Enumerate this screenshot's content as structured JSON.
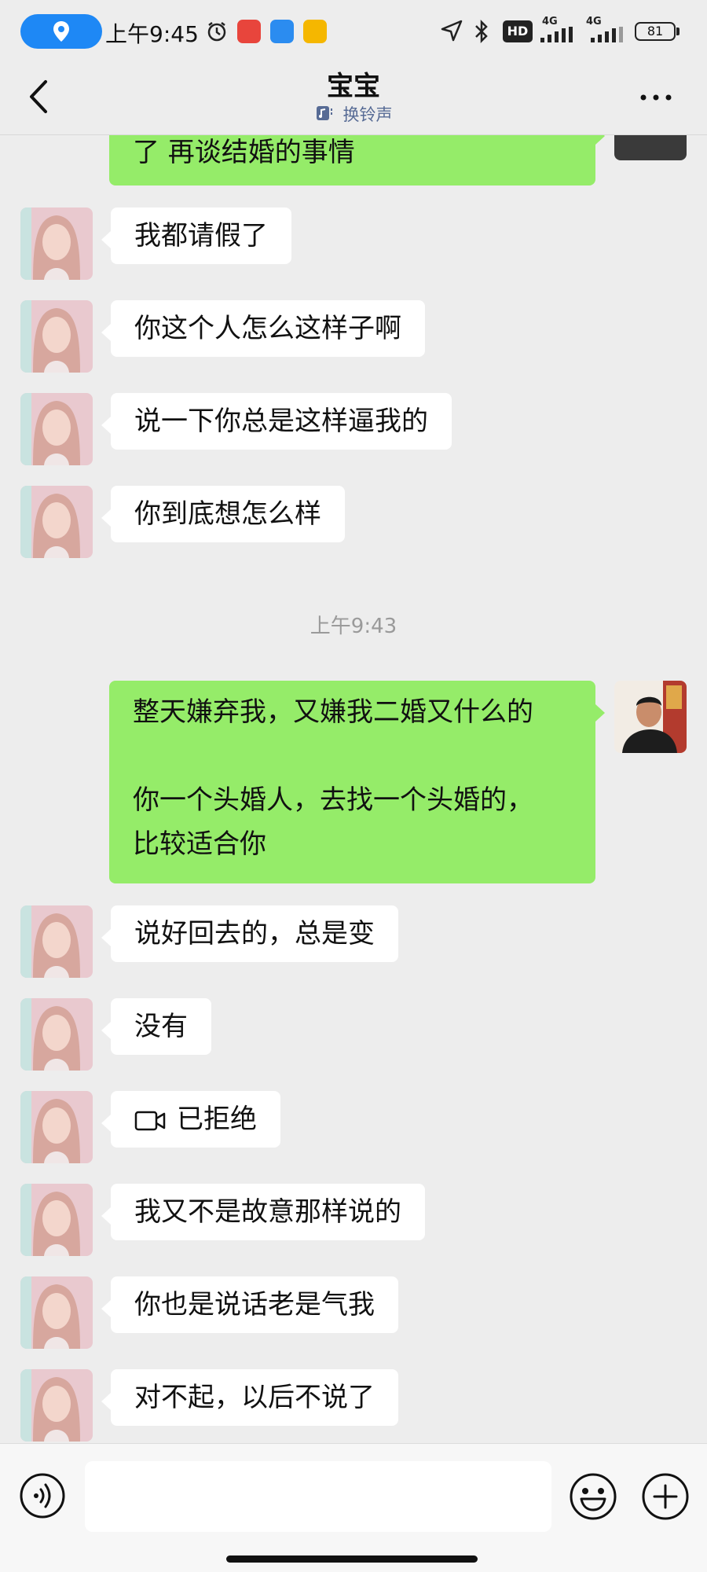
{
  "status_bar": {
    "time": "上午9:45",
    "network_1": "4G",
    "network_2": "4G",
    "hd_label": "HD",
    "battery": "81"
  },
  "navbar": {
    "title": "宝宝",
    "subtitle": "换铃声"
  },
  "messages": {
    "m0": "了  再谈结婚的事情",
    "m1": "我都请假了",
    "m2": "你这个人怎么这样子啊",
    "m3": "说一下你总是这样逼我的",
    "m4": "你到底想怎么样",
    "timestamp": "上午9:43",
    "m5_line1": "整天嫌弃我，又嫌我二婚又什么的",
    "m5_line2": "你一个头婚人，去找一个头婚的，",
    "m5_line3": "比较适合你",
    "m6": "说好回去的，总是变",
    "m7": "没有",
    "m8": "已拒绝",
    "m9": "我又不是故意那样说的",
    "m10": "你也是说话老是气我",
    "m11": "对不起，以后不说了"
  },
  "colors": {
    "background": "#ededed",
    "sent_bubble": "#95ec69",
    "received_bubble": "#ffffff",
    "subtitle_link": "#576b95",
    "location_pill": "#1e88f5"
  },
  "icons": {
    "back": "chevron-left-icon",
    "more": "more-dots-icon",
    "voice": "voice-icon",
    "emoji": "emoji-icon",
    "plus": "plus-icon",
    "video_call": "video-camera-icon"
  }
}
